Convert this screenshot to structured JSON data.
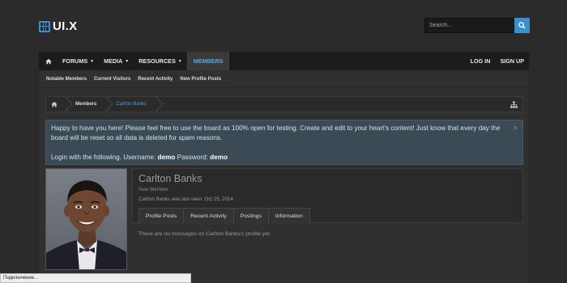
{
  "logo": {
    "text": "UI.X"
  },
  "search": {
    "placeholder": "Search...",
    "icon": "search-icon"
  },
  "nav": {
    "items": [
      {
        "label": "FORUMS",
        "has_caret": true
      },
      {
        "label": "MEDIA",
        "has_caret": true
      },
      {
        "label": "RESOURCES",
        "has_caret": true
      },
      {
        "label": "MEMBERS",
        "active": true
      }
    ],
    "login": "LOG IN",
    "signup": "SIGN UP"
  },
  "subnav": {
    "items": [
      "Notable Members",
      "Current Visitors",
      "Recent Activity",
      "New Profile Posts"
    ]
  },
  "breadcrumb": {
    "items": [
      "Members",
      "Carlton Banks"
    ]
  },
  "notice": {
    "line1": "Happy to have you here! Please feel free to use the board as 100% open for testing. Create and edit to your heart's content! Just know that every day the board will be reset so all data is deleted for spam reasons.",
    "login_prefix": "Login with the following. Username: ",
    "username": "demo",
    "password_label": " Password: ",
    "password": "demo",
    "close": "×"
  },
  "profile": {
    "name": "Carlton Banks",
    "title": "New Member",
    "last_seen": "Carlton Banks was last seen: Oct 15, 2014",
    "tabs": [
      "Profile Posts",
      "Recent Activity",
      "Postings",
      "Information"
    ],
    "empty_message": "There are no messages on Carlton Banks's profile yet."
  },
  "statusbar": {
    "text": "Подключение..."
  },
  "colors": {
    "accent": "#3b8fcf",
    "link": "#4f9ee0",
    "notice_bg": "#3b4a55"
  }
}
